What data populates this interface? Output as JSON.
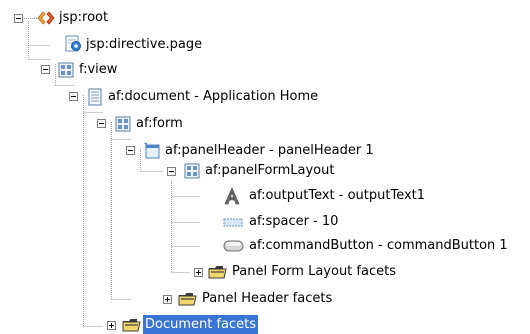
{
  "tree": {
    "nodes": [
      {
        "label": "jsp:root",
        "icon": "jsp-root-icon",
        "toggle": "expanded"
      },
      {
        "label": "jsp:directive.page",
        "icon": "directive-icon",
        "toggle": "none"
      },
      {
        "label": "f:view",
        "icon": "container-icon",
        "toggle": "expanded"
      },
      {
        "label": "af:document - Application Home",
        "icon": "document-icon",
        "toggle": "expanded"
      },
      {
        "label": "af:form",
        "icon": "container-icon",
        "toggle": "expanded"
      },
      {
        "label": "af:panelHeader - panelHeader 1",
        "icon": "panel-header-icon",
        "toggle": "expanded"
      },
      {
        "label": "af:panelFormLayout",
        "icon": "container-icon",
        "toggle": "expanded"
      },
      {
        "label": "af:outputText - outputText1",
        "icon": "output-text-icon",
        "toggle": "none"
      },
      {
        "label": "af:spacer - 10",
        "icon": "spacer-icon",
        "toggle": "none"
      },
      {
        "label": "af:commandButton - commandButton 1",
        "icon": "command-button-icon",
        "toggle": "none"
      },
      {
        "label": "Panel Form Layout facets",
        "icon": "folder-icon",
        "toggle": "collapsed"
      },
      {
        "label": "Panel Header facets",
        "icon": "folder-icon",
        "toggle": "collapsed"
      },
      {
        "label": "Document facets",
        "icon": "folder-icon",
        "toggle": "collapsed",
        "selected": true
      }
    ]
  },
  "colors": {
    "selection": "#3875d7",
    "guide": "#a0a0a0"
  }
}
